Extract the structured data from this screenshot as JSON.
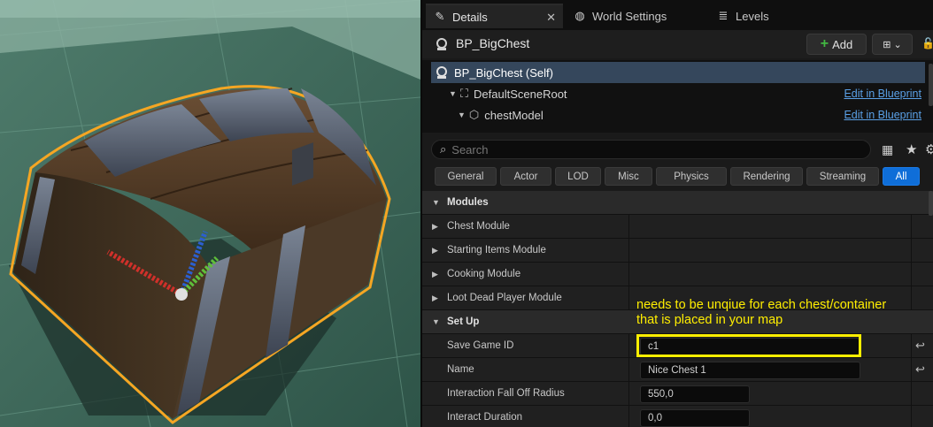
{
  "tabs": [
    {
      "label": "Details",
      "icon": "pencil-icon",
      "active": true
    },
    {
      "label": "World Settings",
      "icon": "globe-icon",
      "active": false
    },
    {
      "label": "Levels",
      "icon": "levels-icon",
      "active": false
    }
  ],
  "tab_close": "✕",
  "header": {
    "title": "BP_BigChest",
    "add_label": "Add",
    "add_plus": "+",
    "combo_glyph": "⊞ ⌄",
    "lock_glyph": "🔓"
  },
  "tree": {
    "rows": [
      {
        "label": "BP_BigChest (Self)"
      },
      {
        "label": "DefaultSceneRoot",
        "link": "Edit in Blueprint"
      },
      {
        "label": "chestModel",
        "link": "Edit in Blueprint"
      }
    ]
  },
  "search": {
    "placeholder": "Search",
    "value": ""
  },
  "filters": [
    "General",
    "Actor",
    "LOD",
    "Misc",
    "Physics",
    "Rendering",
    "Streaming",
    "All"
  ],
  "active_filter": "All",
  "categories": {
    "modules": "Modules",
    "setup": "Set Up"
  },
  "modules": [
    "Chest Module",
    "Starting Items Module",
    "Cooking Module",
    "Loot Dead Player Module"
  ],
  "setup": [
    {
      "label": "Save Game ID",
      "value": "c1"
    },
    {
      "label": "Name",
      "value": "Nice Chest 1"
    },
    {
      "label": "Interaction Fall Off Radius",
      "value": "550,0"
    },
    {
      "label": "Interact Duration",
      "value": "0,0"
    }
  ],
  "annotation": {
    "line1": "needs to be unqiue for each chest/container",
    "line2": "that is placed in your map"
  },
  "colors": {
    "accent": "#0f6ed8",
    "selection": "#35475c",
    "link": "#5aa0e6",
    "annotation": "#ffee00",
    "outline": "#f5a623"
  }
}
